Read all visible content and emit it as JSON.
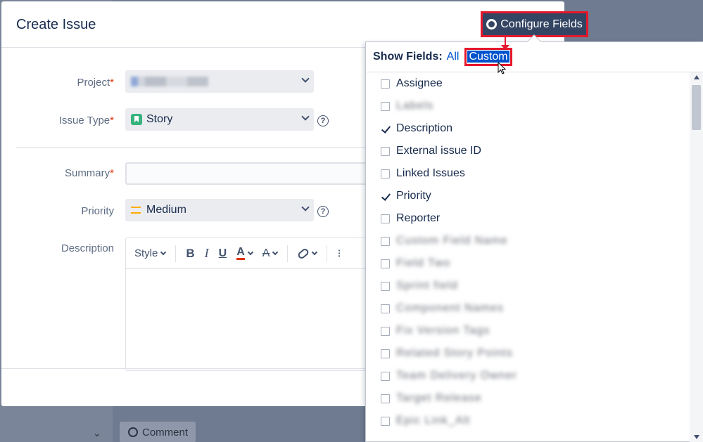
{
  "background": {
    "comment_label": "Comment"
  },
  "dialog": {
    "title": "Create Issue",
    "fields": {
      "project": {
        "label": "Project",
        "required_mark": "*"
      },
      "issue_type": {
        "label": "Issue Type",
        "required_mark": "*",
        "value": "Story"
      },
      "summary": {
        "label": "Summary",
        "required_mark": "*",
        "value": ""
      },
      "priority": {
        "label": "Priority",
        "value": "Medium"
      },
      "description": {
        "label": "Description"
      }
    },
    "editor_toolbar": {
      "style_label": "Style",
      "bold": "B",
      "italic": "I",
      "underline": "U",
      "text_color": "A",
      "clear_format": "A"
    }
  },
  "configure_fields": {
    "button_label": "Configure Fields",
    "show_fields_label": "Show Fields:",
    "option_all": "All",
    "option_custom": "Custom",
    "fields": [
      {
        "label": "Assignee",
        "checked": false,
        "blurred": false
      },
      {
        "label": "Labels",
        "checked": false,
        "blurred": true
      },
      {
        "label": "Description",
        "checked": true,
        "blurred": false
      },
      {
        "label": "External issue ID",
        "checked": false,
        "blurred": false
      },
      {
        "label": "Linked Issues",
        "checked": false,
        "blurred": false
      },
      {
        "label": "Priority",
        "checked": true,
        "blurred": false
      },
      {
        "label": "Reporter",
        "checked": false,
        "blurred": false
      },
      {
        "label": "Custom Field Name",
        "checked": false,
        "blurred": true
      },
      {
        "label": "Field Two",
        "checked": false,
        "blurred": true
      },
      {
        "label": "Sprint field",
        "checked": false,
        "blurred": true
      },
      {
        "label": "Component Names",
        "checked": false,
        "blurred": true
      },
      {
        "label": "Fix Version Tags",
        "checked": false,
        "blurred": true
      },
      {
        "label": "Related Story Points",
        "checked": false,
        "blurred": true
      },
      {
        "label": "Team Delivery Owner",
        "checked": false,
        "blurred": true
      },
      {
        "label": "Target Release",
        "checked": false,
        "blurred": true
      },
      {
        "label": "Epic Link_Alt",
        "checked": false,
        "blurred": true
      }
    ]
  },
  "colors": {
    "accent": "#0052cc",
    "highlight": "#e5182d",
    "button_bg": "#344563"
  }
}
